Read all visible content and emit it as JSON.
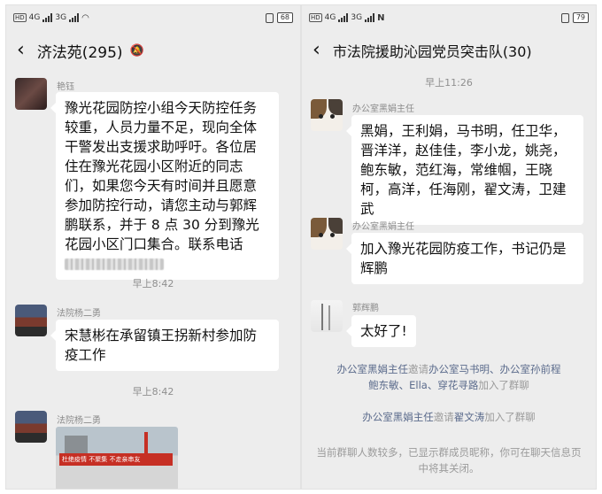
{
  "left": {
    "status": {
      "network": "4G",
      "network2": "3G",
      "battery": "68"
    },
    "title": "济法苑(295)",
    "messages": [
      {
        "sender": "艳钰",
        "text": "豫光花园防控小组今天防控任务较重，人员力量不足，现向全体干警发出支援求助呼吁。各位居住在豫光花园小区附近的同志们，如果您今天有时间并且愿意参加防控行动，请您主动与郭辉鹏联系，并于 8 点 30 分到豫光花园小区门口集合。联系电话"
      },
      {
        "time": "早上8:42"
      },
      {
        "sender": "法院杨二勇",
        "text": "宋慧彬在承留镇王拐新村参加防疫工作"
      },
      {
        "time": "早上8:42"
      },
      {
        "sender": "法院杨二勇",
        "banner": "杜绝疫情 不聚集 不走亲串友"
      }
    ]
  },
  "right": {
    "status": {
      "network": "4G",
      "network2": "3G",
      "battery": "79"
    },
    "title": "市法院援助沁园党员突击队(30)",
    "time_top": "早上11:26",
    "messages": [
      {
        "sender": "办公室黑娟主任",
        "text": "黑娟，王利娟，马书明，任卫华，晋洋洋，赵佳佳，李小龙，姚尧，鲍东敏，范红海，常维帼，王晓柯，高洋，任海刚，翟文涛，卫建武"
      },
      {
        "sender": "办公室黑娟主任",
        "text": "加入豫光花园防疫工作，书记仍是辉鹏"
      },
      {
        "sender": "郭辉鹏",
        "text": "太好了!"
      }
    ],
    "sys1": {
      "inviter": "办公室黑娟主任",
      "verb": "邀请",
      "invitees1": "办公室马书明、办公室孙前程",
      "invitees2": "鲍东敏、Ella、穿花寻路",
      "tail": "加入了群聊"
    },
    "sys2": {
      "inviter": "办公室黑娟主任",
      "verb": "邀请",
      "invitee": "翟文涛",
      "tail": "加入了群聊"
    },
    "sys3": "当前群聊人数较多，已显示群成员昵称，你可在聊天信息页中将其关闭。"
  }
}
